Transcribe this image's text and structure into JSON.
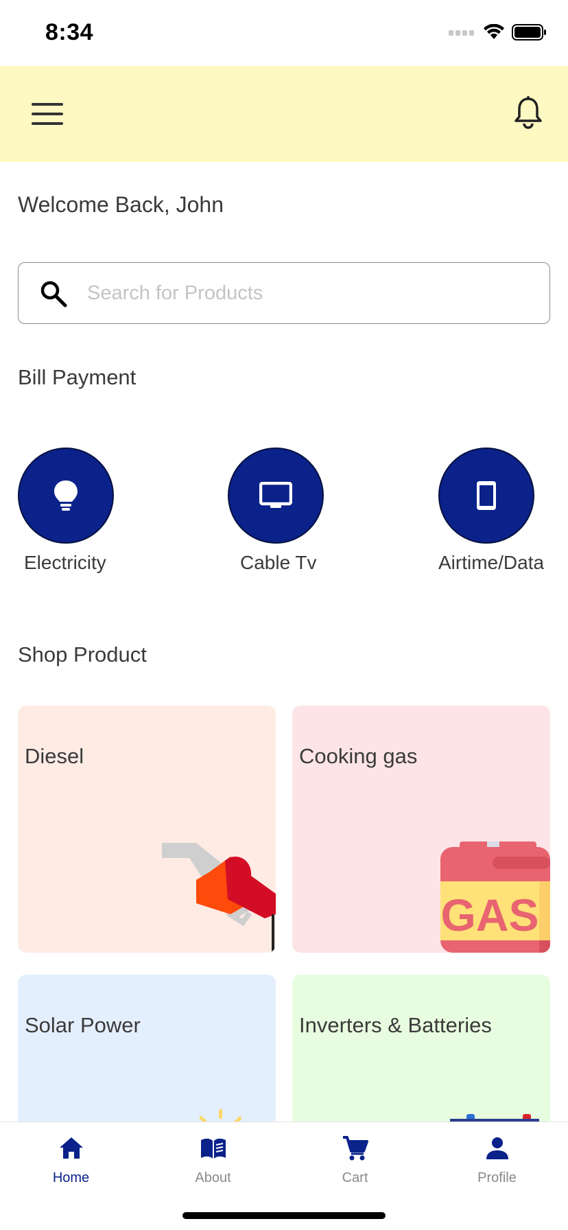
{
  "status_bar": {
    "time": "8:34"
  },
  "header": {
    "menu_icon": "hamburger-menu-icon",
    "notification_icon": "bell-icon"
  },
  "welcome": {
    "text": "Welcome Back, John"
  },
  "search": {
    "placeholder": "Search for Products",
    "value": ""
  },
  "bill_payment": {
    "title": "Bill Payment",
    "items": [
      {
        "label": "Electricity",
        "icon": "lightbulb-icon"
      },
      {
        "label": "Cable Tv",
        "icon": "tv-icon"
      },
      {
        "label": "Airtime/Data",
        "icon": "mobile-phone-icon"
      }
    ]
  },
  "shop": {
    "title": "Shop Product",
    "products": [
      {
        "label": "Diesel",
        "background": "#feebe4"
      },
      {
        "label": "Cooking gas",
        "background": "#fde4e6",
        "art_text": "GAS"
      },
      {
        "label": "Solar Power",
        "background": "#e4effd"
      },
      {
        "label": "Inverters & Batteries",
        "background": "#e8fde0"
      }
    ]
  },
  "tab_bar": {
    "tabs": [
      {
        "label": "Home",
        "icon": "home-icon",
        "active": true
      },
      {
        "label": "About",
        "icon": "book-icon",
        "active": false
      },
      {
        "label": "Cart",
        "icon": "cart-icon",
        "active": false
      },
      {
        "label": "Profile",
        "icon": "person-icon",
        "active": false
      }
    ]
  },
  "colors": {
    "primary": "#0a2289",
    "header_bg": "#fef9c3",
    "inactive_tab": "#8a8a8a"
  }
}
